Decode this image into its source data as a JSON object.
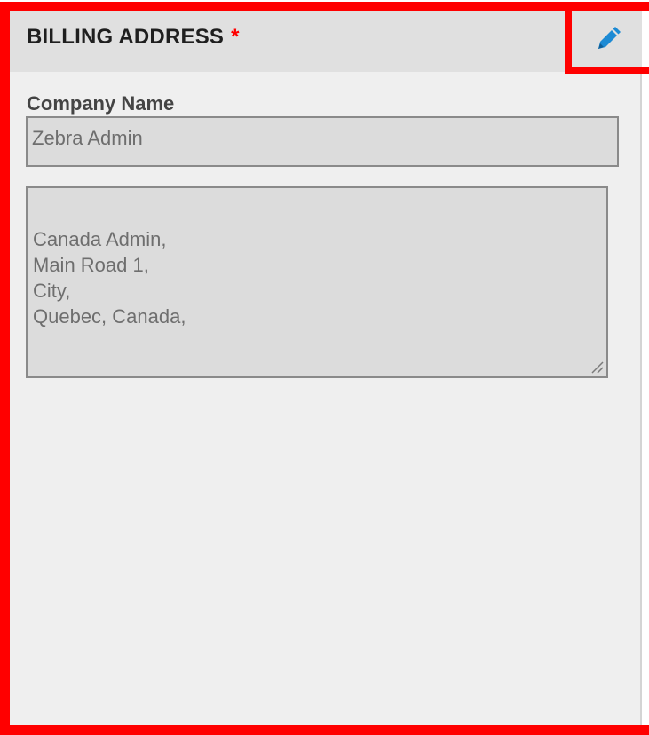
{
  "billing_address": {
    "title": "BILLING ADDRESS",
    "required_marker": "*",
    "edit_icon": "pencil-icon",
    "company_name": {
      "label": "Company Name",
      "value": "Zebra Admin"
    },
    "address": {
      "value": "Canada Admin,\nMain Road 1,\nCity,\nQuebec, Canada,"
    }
  },
  "colors": {
    "highlight": "#ff0000",
    "required": "#ff0000",
    "edit_icon": "#1c8ad4",
    "header_bg": "#e0e0e0",
    "panel_bg": "#efefef",
    "field_bg": "#dcdcdc"
  }
}
